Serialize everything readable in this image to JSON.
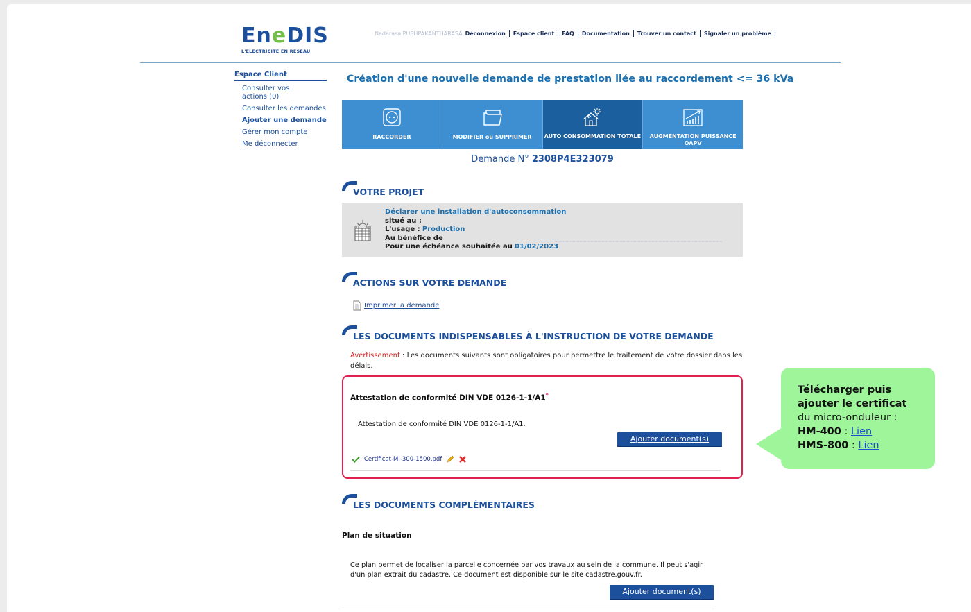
{
  "header": {
    "logo_word": "EnEDIS",
    "logo_tagline": "L'ELECTRICITE EN RESEAU",
    "user_name": "Nadarasa PUSHPAKANTHARASA",
    "nav": [
      "Déconnexion",
      "Espace client",
      "FAQ",
      "Documentation",
      "Trouver un contact",
      "Signaler un problème"
    ]
  },
  "sidebar": {
    "title": "Espace Client",
    "items": [
      {
        "label": "Consulter vos actions (0)"
      },
      {
        "label": "Consulter les demandes"
      },
      {
        "label": "Ajouter une demande"
      },
      {
        "label": "Gérer mon compte"
      },
      {
        "label": "Me déconnecter"
      }
    ]
  },
  "main": {
    "page_title": "Création d'une nouvelle demande de prestation liée au raccordement <= 36 kVa",
    "tabs": [
      {
        "label": "RACCORDER",
        "icon": "plug-socket-icon"
      },
      {
        "label": "MODIFIER ou SUPPRIMER",
        "icon": "folder-icon"
      },
      {
        "label": "AUTO CONSOMMATION TOTALE",
        "icon": "solar-house-icon"
      },
      {
        "label": "AUGMENTATION PUISSANCE OAPV",
        "icon": "growth-chart-icon"
      }
    ],
    "demande_prefix": "Demande N°",
    "demande_number": "2308P4E323079",
    "projet": {
      "section_title": "VOTRE PROJET",
      "line1": "Déclarer une installation d'autoconsommation",
      "line2": "situé au :",
      "usage_label": "L'usage :",
      "usage_value": "Production",
      "line4": "Au bénéfice de",
      "echeance_label": "Pour une échéance souhaitée au",
      "echeance_value": "01/02/2023"
    },
    "actions": {
      "section_title": "ACTIONS SUR VOTRE DEMANDE",
      "print_link": "Imprimer la demande"
    },
    "documents": {
      "section_title": "LES DOCUMENTS INDISPENSABLES À L'INSTRUCTION DE VOTRE DEMANDE",
      "warning_label": "Avertissement",
      "warning_text": " : Les documents suivants sont obligatoires pour permettre le traitement de votre dossier dans les délais.",
      "required_title": "Attestation de conformité DIN VDE 0126-1-1/A1",
      "required_star": "*",
      "required_desc": "Attestation de conformité DIN VDE 0126-1-1/A1.",
      "add_button": "Ajouter document(s)",
      "file_name": "Certificat-MI-300-1500.pdf"
    },
    "complementaires": {
      "section_title": "LES DOCUMENTS COMPLÉMENTAIRES",
      "plan_title": "Plan de situation",
      "plan_desc": "Ce plan permet de localiser la parcelle concernée par vos travaux au sein de la commune. Il peut s'agir d'un plan extrait du cadastre. Ce document est disponible sur le site cadastre.gouv.fr.",
      "add_button": "Ajouter document(s)"
    }
  },
  "callout": {
    "bold_line": "Télécharger puis ajouter le certificat",
    "normal_line": "du micro-onduleur :",
    "items": [
      {
        "model": "HM-400",
        "link": "Lien"
      },
      {
        "model": "HMS-800",
        "link": "Lien"
      }
    ]
  },
  "colors": {
    "brand_blue": "#1c4f9c",
    "tab_blue": "#3d8fd1",
    "tab_active": "#1c5f9e",
    "alert_red": "#e0214f",
    "callout_green": "#9ef59a"
  }
}
